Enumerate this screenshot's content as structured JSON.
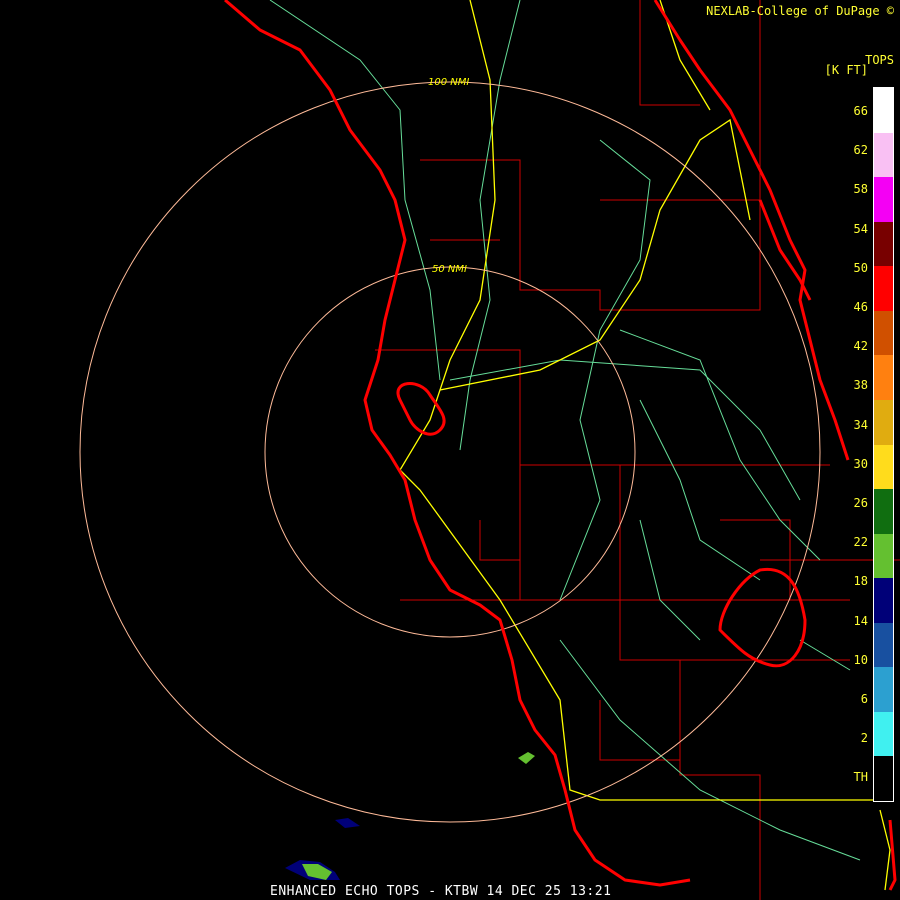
{
  "credit": "NEXLAB-College of DuPage ©",
  "legend": {
    "title": "TOPS",
    "units": "[K FT]",
    "bands": [
      {
        "label": "66",
        "color": "#ffffff"
      },
      {
        "label": "62",
        "color": "#f9c0f3"
      },
      {
        "label": "58",
        "color": "#f400f4"
      },
      {
        "label": "54",
        "color": "#780000"
      },
      {
        "label": "50",
        "color": "#ff0000"
      },
      {
        "label": "46",
        "color": "#d05000"
      },
      {
        "label": "42",
        "color": "#ff8010"
      },
      {
        "label": "38",
        "color": "#e0ac10"
      },
      {
        "label": "34",
        "color": "#ffdc1c"
      },
      {
        "label": "30",
        "color": "#106e10"
      },
      {
        "label": "26",
        "color": "#64c030"
      },
      {
        "label": "22",
        "color": "#000078"
      },
      {
        "label": "18",
        "color": "#1850a0"
      },
      {
        "label": "14",
        "color": "#2ca0d0"
      },
      {
        "label": "10",
        "color": "#40f0f0"
      },
      {
        "label": "6",
        "color": "#000000"
      }
    ],
    "tick_labels": [
      "66",
      "62",
      "58",
      "54",
      "50",
      "46",
      "42",
      "38",
      "34",
      "30",
      "26",
      "22",
      "18",
      "14",
      "10",
      "6",
      "2",
      "TH"
    ]
  },
  "rings": {
    "inner_label": "50 NMI",
    "outer_label": "100 NMI"
  },
  "footer": "ENHANCED ECHO TOPS - KTBW 14 DEC 25 13:21"
}
